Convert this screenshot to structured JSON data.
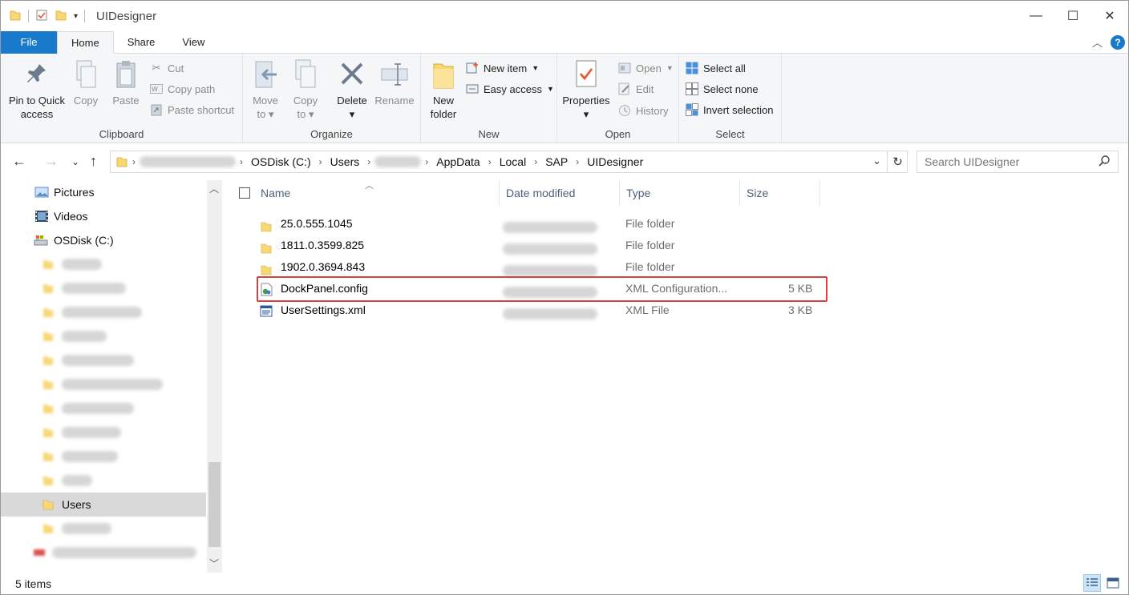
{
  "window": {
    "title": "UIDesigner",
    "controls": {
      "minimize": "—",
      "maximize": "☐",
      "close": "✕"
    }
  },
  "tabs": [
    {
      "label": "File"
    },
    {
      "label": "Home"
    },
    {
      "label": "Share"
    },
    {
      "label": "View"
    }
  ],
  "ribbon": {
    "clipboard": {
      "label": "Clipboard",
      "pin": "Pin to Quick access",
      "pin_line1": "Pin to Quick",
      "pin_line2": "access",
      "copy": "Copy",
      "paste": "Paste",
      "cut": "Cut",
      "copy_path": "Copy path",
      "paste_shortcut": "Paste shortcut"
    },
    "organize": {
      "label": "Organize",
      "move_to_line1": "Move",
      "move_to_line2": "to",
      "copy_to_line1": "Copy",
      "copy_to_line2": "to",
      "delete": "Delete",
      "rename": "Rename"
    },
    "new": {
      "label": "New",
      "new_folder_line1": "New",
      "new_folder_line2": "folder",
      "new_item": "New item",
      "easy_access": "Easy access"
    },
    "open": {
      "label": "Open",
      "properties": "Properties",
      "open": "Open",
      "edit": "Edit",
      "history": "History"
    },
    "select": {
      "label": "Select",
      "select_all": "Select all",
      "select_none": "Select none",
      "invert_selection": "Invert selection"
    }
  },
  "address": {
    "crumbs": [
      "OSDisk (C:)",
      "Users",
      "AppData",
      "Local",
      "SAP",
      "UIDesigner"
    ],
    "search_placeholder": "Search UIDesigner"
  },
  "nav": {
    "items": [
      {
        "label": "Pictures",
        "icon": "pictures-icon"
      },
      {
        "label": "Videos",
        "icon": "videos-icon"
      },
      {
        "label": "OSDisk (C:)",
        "icon": "drive-icon"
      },
      {
        "label": "Users",
        "icon": "folder-icon",
        "selected": true
      }
    ]
  },
  "columns": {
    "name": "Name",
    "date_modified": "Date modified",
    "type": "Type",
    "size": "Size"
  },
  "files": [
    {
      "name": "25.0.555.1045",
      "type": "File folder",
      "size": "",
      "icon": "folder-icon"
    },
    {
      "name": "1811.0.3599.825",
      "type": "File folder",
      "size": "",
      "icon": "folder-icon"
    },
    {
      "name": "1902.0.3694.843",
      "type": "File folder",
      "size": "",
      "icon": "folder-icon"
    },
    {
      "name": "DockPanel.config",
      "type": "XML Configuration...",
      "size": "5 KB",
      "icon": "config-file-icon",
      "highlighted": true
    },
    {
      "name": "UserSettings.xml",
      "type": "XML File",
      "size": "3 KB",
      "icon": "xml-file-icon"
    }
  ],
  "status": {
    "item_count": "5 items"
  },
  "colors": {
    "accent": "#1979ca",
    "highlight_box": "#d9413e",
    "folder": "#f8d775"
  }
}
